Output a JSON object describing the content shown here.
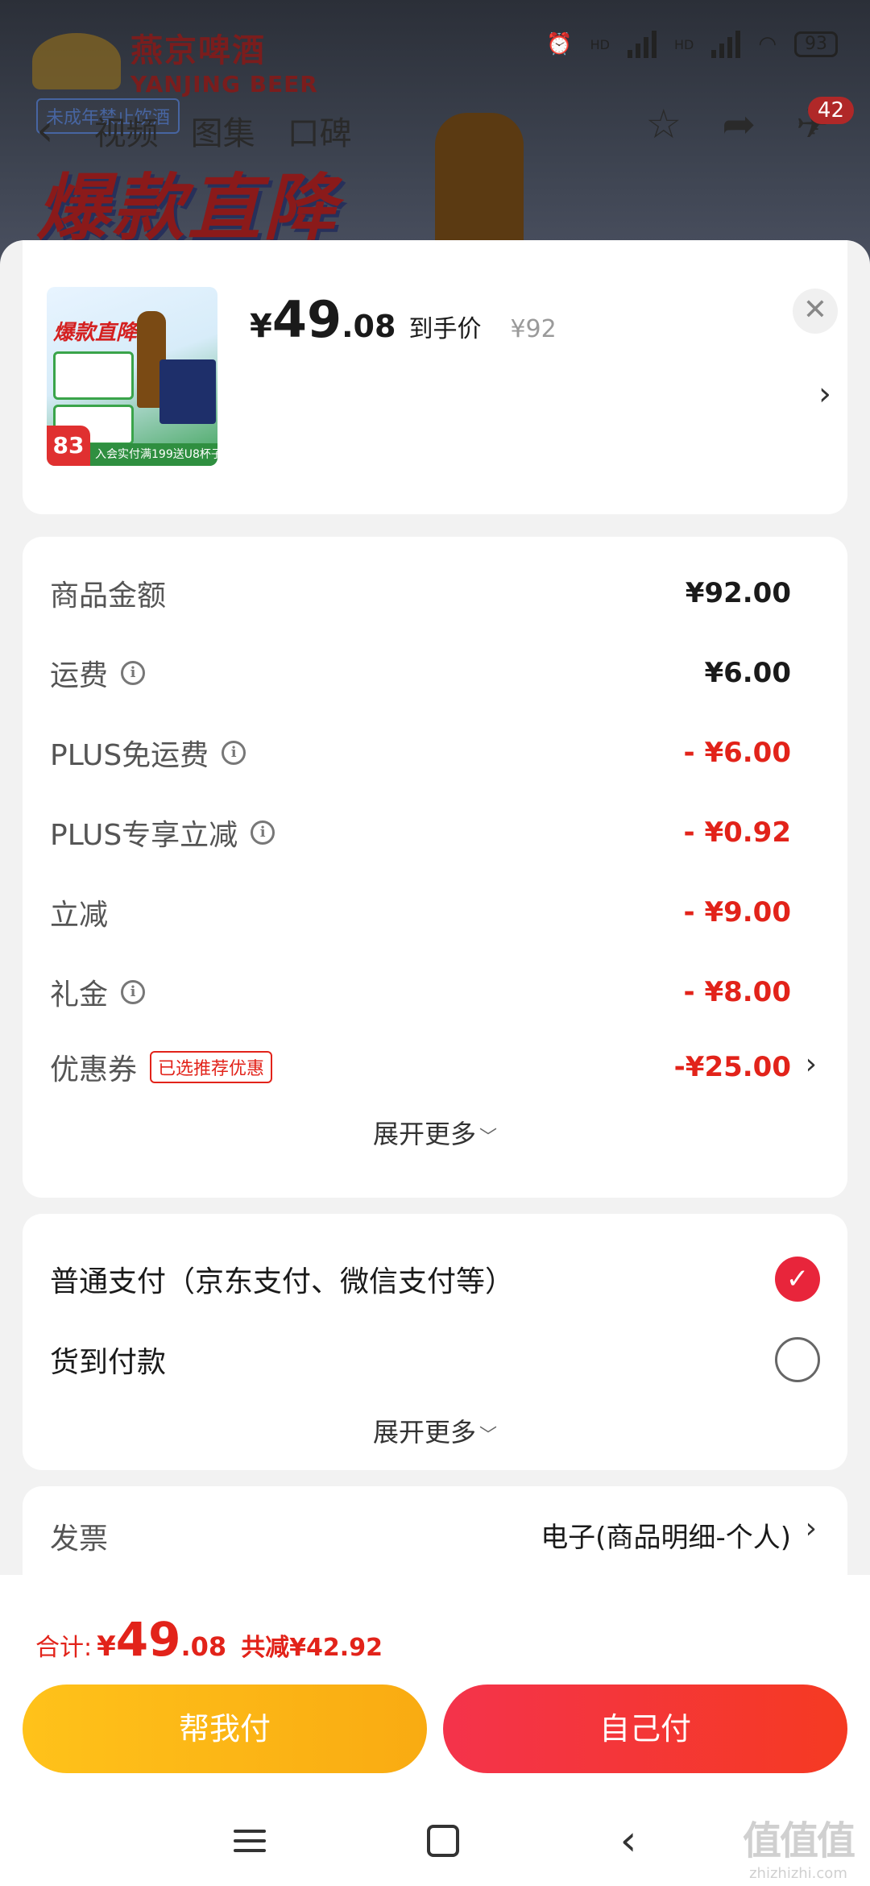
{
  "background": {
    "brand_cn": "燕京啤酒",
    "brand_en": "YANJING BEER",
    "badge": "未成年禁止饮酒",
    "tabs": [
      "视频",
      "图集",
      "口碑"
    ],
    "count": "42",
    "banner": "爆款直降",
    "battery": "93",
    "hd1": "HD",
    "hd2": "HD"
  },
  "product": {
    "price_currency": "¥",
    "price_int": "49",
    "price_dec": ".08",
    "price_label": "到手价",
    "original_price": "¥92",
    "thumb_title": "爆款直降",
    "thumb_percent": "83",
    "thumb_strip": "入会实付满199送U8杯子"
  },
  "fees": {
    "rows": [
      {
        "label": "商品金额",
        "value": "¥92.00"
      },
      {
        "label": "运费",
        "value": "¥6.00"
      },
      {
        "label": "PLUS免运费",
        "value": "- ¥6.00"
      },
      {
        "label": "PLUS专享立减",
        "value": "- ¥0.92"
      },
      {
        "label": "立减",
        "value": "- ¥9.00"
      },
      {
        "label": "礼金",
        "value": "- ¥8.00"
      },
      {
        "label": "优惠券",
        "value": "-¥25.00",
        "tag": "已选推荐优惠"
      }
    ],
    "expand": "展开更多"
  },
  "payment": {
    "options": [
      {
        "label": "普通支付（京东支付、微信支付等）",
        "selected": true
      },
      {
        "label": "货到付款",
        "selected": false
      }
    ],
    "expand": "展开更多"
  },
  "invoice": {
    "label": "发票",
    "value": "电子(商品明细-个人)"
  },
  "footer": {
    "total_label": "合计:",
    "total_currency": "¥",
    "total_int": "49",
    "total_dec": ".08",
    "savings": "共减¥42.92",
    "help_pay": "帮我付",
    "self_pay": "自己付"
  },
  "watermark": {
    "logo": "值值值",
    "url": "zhizhizhi.com"
  },
  "colors": {
    "accent_red": "#e2231a",
    "pay_red": "#f4334b",
    "help_yellow": "#ffc21a"
  }
}
